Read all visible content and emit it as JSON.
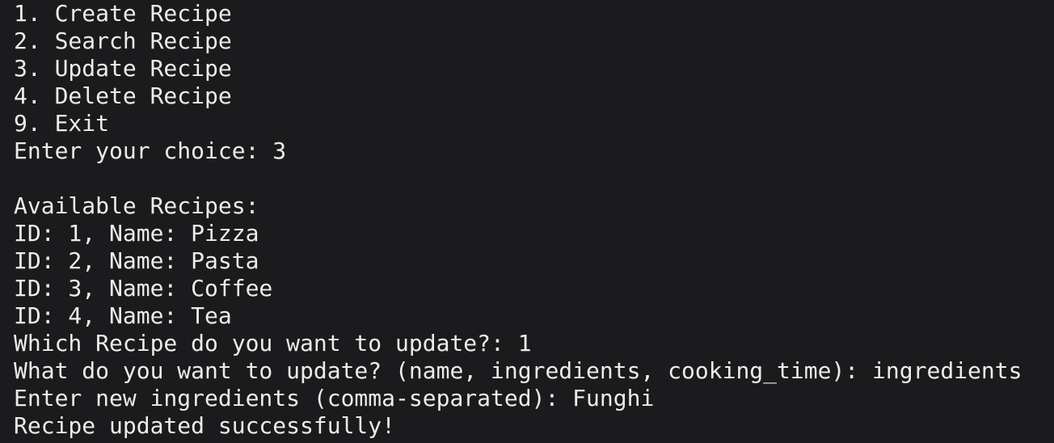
{
  "terminal": {
    "menu": [
      "1. Create Recipe",
      "2. Search Recipe",
      "3. Update Recipe",
      "4. Delete Recipe",
      "9. Exit"
    ],
    "choice_prompt": "Enter your choice: ",
    "choice_value": "3",
    "available_header": "Available Recipes:",
    "recipes": [
      "ID: 1, Name: Pizza",
      "ID: 2, Name: Pasta",
      "ID: 3, Name: Coffee",
      "ID: 4, Name: Tea"
    ],
    "which_prompt": "Which Recipe do you want to update?: ",
    "which_value": "1",
    "what_prompt": "What do you want to update? (name, ingredients, cooking_time): ",
    "what_value": "ingredients",
    "ingredients_prompt": "Enter new ingredients (comma-separated): ",
    "ingredients_value": "Funghi",
    "success_message": "Recipe updated successfully!"
  },
  "colors": {
    "background": "#1b1b1d",
    "text": "#ececec"
  }
}
